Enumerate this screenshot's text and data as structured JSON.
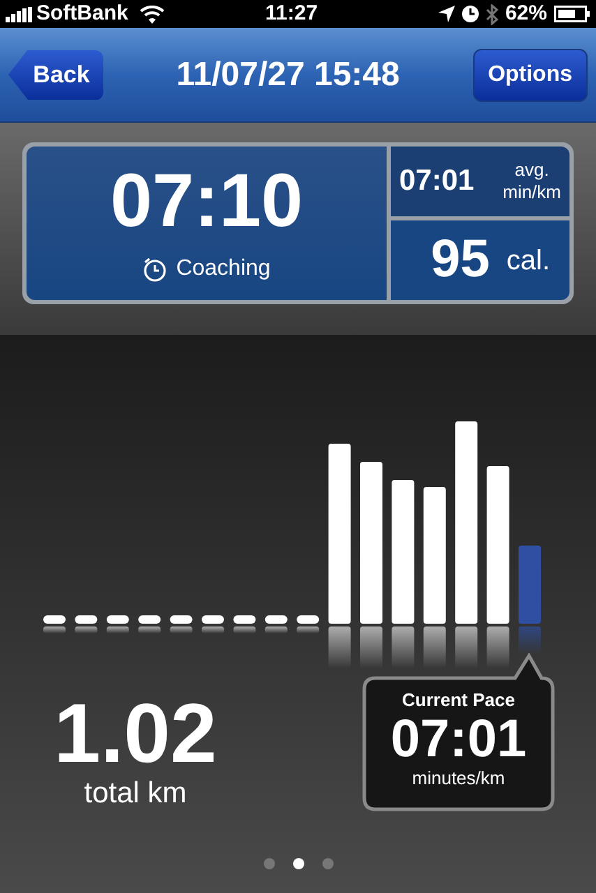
{
  "status_bar": {
    "carrier": "SoftBank",
    "time": "11:27",
    "battery": "62%"
  },
  "nav": {
    "back": "Back",
    "title": "11/07/27 15:48",
    "options": "Options"
  },
  "summary": {
    "duration": "07:10",
    "coaching": "Coaching",
    "avg_pace": "07:01",
    "avg_label": "avg.",
    "avg_unit": "min/km",
    "calories": "95",
    "calories_unit": "cal."
  },
  "distance": {
    "value": "1.02",
    "label": "total km"
  },
  "current_pace": {
    "title": "Current Pace",
    "value": "07:01",
    "unit": "minutes/km"
  },
  "pages": [
    {
      "selected": false
    },
    {
      "selected": true
    },
    {
      "selected": false
    }
  ]
}
